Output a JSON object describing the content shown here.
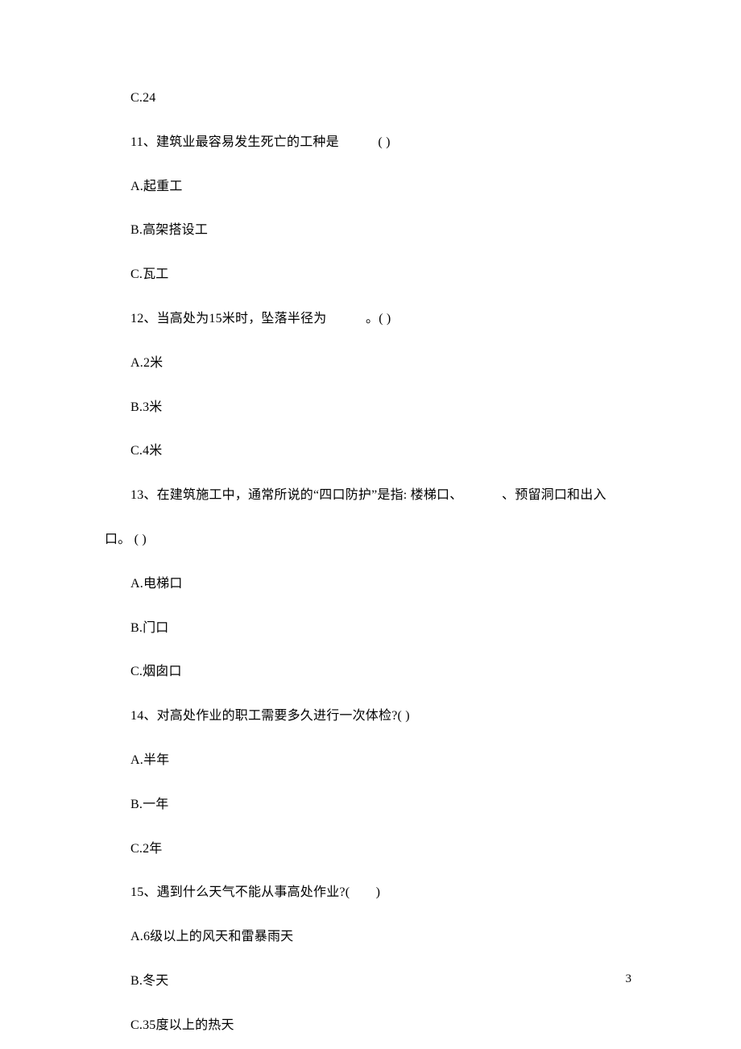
{
  "lines": [
    {
      "text": "C.24",
      "indent": true
    },
    {
      "text": "11、建筑业最容易发生死亡的工种是   ( )",
      "indent": true
    },
    {
      "text": "A.起重工",
      "indent": true
    },
    {
      "text": "B.高架搭设工",
      "indent": true
    },
    {
      "text": "C.瓦工",
      "indent": true
    },
    {
      "text": "12、当高处为15米时，坠落半径为   。( )",
      "indent": true
    },
    {
      "text": "A.2米",
      "indent": true
    },
    {
      "text": "B.3米",
      "indent": true
    },
    {
      "text": "C.4米",
      "indent": true
    },
    {
      "text": "13、在建筑施工中，通常所说的“四口防护”是指: 楼梯口、   、预留洞口和出入",
      "indent": true
    },
    {
      "text": "口。 ( )",
      "indent": false
    },
    {
      "text": "A.电梯口",
      "indent": true
    },
    {
      "text": "B.门口",
      "indent": true
    },
    {
      "text": "C.烟囱口",
      "indent": true
    },
    {
      "text": "14、对高处作业的职工需要多久进行一次体检?( )",
      "indent": true
    },
    {
      "text": "A.半年",
      "indent": true
    },
    {
      "text": "B.一年",
      "indent": true
    },
    {
      "text": "C.2年",
      "indent": true
    },
    {
      "text": "15、遇到什么天气不能从事高处作业?(  )",
      "indent": true
    },
    {
      "text": "A.6级以上的风天和雷暴雨天",
      "indent": true
    },
    {
      "text": "B.冬天",
      "indent": true
    },
    {
      "text": "C.35度以上的热天",
      "indent": true
    }
  ],
  "pageNumber": "3"
}
